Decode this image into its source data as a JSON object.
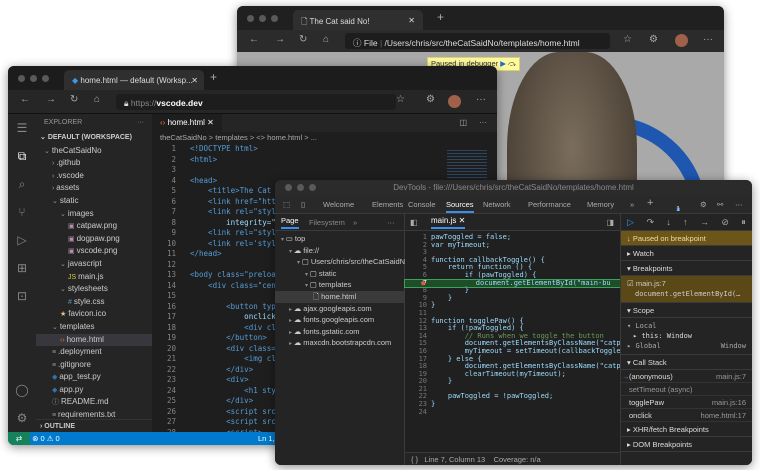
{
  "browser": {
    "tab_title": "The Cat said No!",
    "address_scheme": "File",
    "address_path": "/Users/chris/src/theCatSaidNo/templates/home.html",
    "paused_banner": "Paused in debugger",
    "page_bg": "#a9a9a9"
  },
  "vscode": {
    "tab_title": "home.html — default (Worksp...",
    "url_prefix": "https://",
    "url_host": "vscode.dev",
    "explorer_title": "EXPLORER",
    "workspace": "DEFAULT (WORKSPACE)",
    "tree": [
      {
        "label": "theCatSaidNo",
        "indent": 1,
        "icon": "chevron-down"
      },
      {
        "label": ".github",
        "indent": 2,
        "icon": "chevron-right"
      },
      {
        "label": ".vscode",
        "indent": 2,
        "icon": "chevron-right"
      },
      {
        "label": "assets",
        "indent": 2,
        "icon": "chevron-right"
      },
      {
        "label": "static",
        "indent": 2,
        "icon": "chevron-down"
      },
      {
        "label": "images",
        "indent": 3,
        "icon": "chevron-down"
      },
      {
        "label": "catpaw.png",
        "indent": 4,
        "icon": "image"
      },
      {
        "label": "dogpaw.png",
        "indent": 4,
        "icon": "image"
      },
      {
        "label": "vscode.png",
        "indent": 4,
        "icon": "image"
      },
      {
        "label": "javascript",
        "indent": 3,
        "icon": "chevron-down"
      },
      {
        "label": "main.js",
        "indent": 4,
        "icon": "js"
      },
      {
        "label": "stylesheets",
        "indent": 3,
        "icon": "chevron-down"
      },
      {
        "label": "style.css",
        "indent": 4,
        "icon": "css"
      },
      {
        "label": "favicon.ico",
        "indent": 3,
        "icon": "star"
      },
      {
        "label": "templates",
        "indent": 2,
        "icon": "chevron-down"
      },
      {
        "label": "home.html",
        "indent": 3,
        "icon": "html",
        "selected": true
      },
      {
        "label": ".deployment",
        "indent": 2,
        "icon": "lines"
      },
      {
        "label": ".gitignore",
        "indent": 2,
        "icon": "lines"
      },
      {
        "label": "app_test.py",
        "indent": 2,
        "icon": "python"
      },
      {
        "label": "app.py",
        "indent": 2,
        "icon": "python"
      },
      {
        "label": "README.md",
        "indent": 2,
        "icon": "info"
      },
      {
        "label": "requirements.txt",
        "indent": 2,
        "icon": "lines"
      }
    ],
    "outline": "OUTLINE",
    "editor_tab": "home.html",
    "breadcrumb": "theCatSaidNo > templates > <> home.html > ...",
    "code": [
      "<!DOCTYPE html>",
      "<html>",
      "",
      "<head>",
      "    <title>The Cat s",
      "    <link href=\"http",
      "    <link rel=\"style",
      "        integrity=\"s",
      "    <link rel=\"style",
      "    <link rel='style",
      "</head>",
      "",
      "<body class=\"preload",
      "    <div class=\"cent",
      "",
      "        <button type",
      "            onclick=",
      "            <div cla",
      "        </button>",
      "        <div class=\"",
      "            <img cla",
      "        </div>",
      "        <div>",
      "            <h1 styl",
      "        </div>",
      "        <script src=",
      "        <script src=",
      "        <script>"
    ],
    "status_errors": "0",
    "status_warnings": "0",
    "status_position": "Ln 1,"
  },
  "devtools": {
    "title": "DevTools - file:///Users/chris/src/theCatSaidNo/templates/home.html",
    "tabs": [
      "Welcome",
      "Elements",
      "Console",
      "Sources",
      "Network",
      "Performance",
      "Memory"
    ],
    "active_tab": "Sources",
    "issues_count": "1",
    "nav_tabs": [
      "Page",
      "Filesystem"
    ],
    "nav_tree": [
      {
        "label": "top",
        "indent": 0,
        "icon": "frame"
      },
      {
        "label": "file://",
        "indent": 1,
        "icon": "cloud"
      },
      {
        "label": "Users/chris/src/theCatSaidNo",
        "indent": 2,
        "icon": "folder"
      },
      {
        "label": "static",
        "indent": 3,
        "icon": "folder"
      },
      {
        "label": "templates",
        "indent": 3,
        "icon": "folder"
      },
      {
        "label": "home.html",
        "indent": 4,
        "icon": "file",
        "selected": true
      },
      {
        "label": "ajax.googleapis.com",
        "indent": 1,
        "icon": "cloud"
      },
      {
        "label": "fonts.googleapis.com",
        "indent": 1,
        "icon": "cloud"
      },
      {
        "label": "fonts.gstatic.com",
        "indent": 1,
        "icon": "cloud"
      },
      {
        "label": "maxcdn.bootstrapcdn.com",
        "indent": 1,
        "icon": "cloud"
      }
    ],
    "file_tab": "main.js",
    "code": [
      "pawToggled = false;",
      "var myTimeout;",
      "",
      "function callbackToggle() {",
      "    return function () {",
      "        if (pawToggled) {",
      "            document.getElementById(\"main-bu",
      "        }",
      "    }",
      "}",
      "",
      "function togglePaw() {",
      "    if (!pawToggled) {",
      "        // Runs when we toggle the button",
      "        document.getElementsByClassName(\"catpaw-",
      "        myTimeout = setTimeout(callbackToggle(),",
      "    } else {",
      "        document.getElementsByClassName(\"catpaw-",
      "        clearTimeout(myTimeout);",
      "    }",
      "",
      "    pawToggled = !pawToggled;",
      "}",
      ""
    ],
    "paused_line": 7,
    "status": "Line 7, Column 13",
    "coverage": "Coverage: n/a",
    "paused_label": "Paused on breakpoint",
    "sections": {
      "watch": "Watch",
      "breakpoints": "Breakpoints",
      "scope": "Scope",
      "callstack": "Call Stack",
      "xhr": "XHR/fetch Breakpoints",
      "dom": "DOM Breakpoints"
    },
    "breakpoint": {
      "file": "main.js:7",
      "code": "document.getElementById(…"
    },
    "scope": {
      "local": "Local",
      "this": "this: Window",
      "global": "Global",
      "global_value": "Window"
    },
    "call_stack": [
      {
        "fn": "(anonymous)",
        "loc": "main.js:7",
        "current": true
      },
      {
        "fn": "setTimeout (async)",
        "loc": "",
        "async": true
      },
      {
        "fn": "togglePaw",
        "loc": "main.js:16"
      },
      {
        "fn": "onclick",
        "loc": "home.html:17"
      }
    ],
    "accent": "#3aa357",
    "paused_bg": "#6b5518"
  }
}
